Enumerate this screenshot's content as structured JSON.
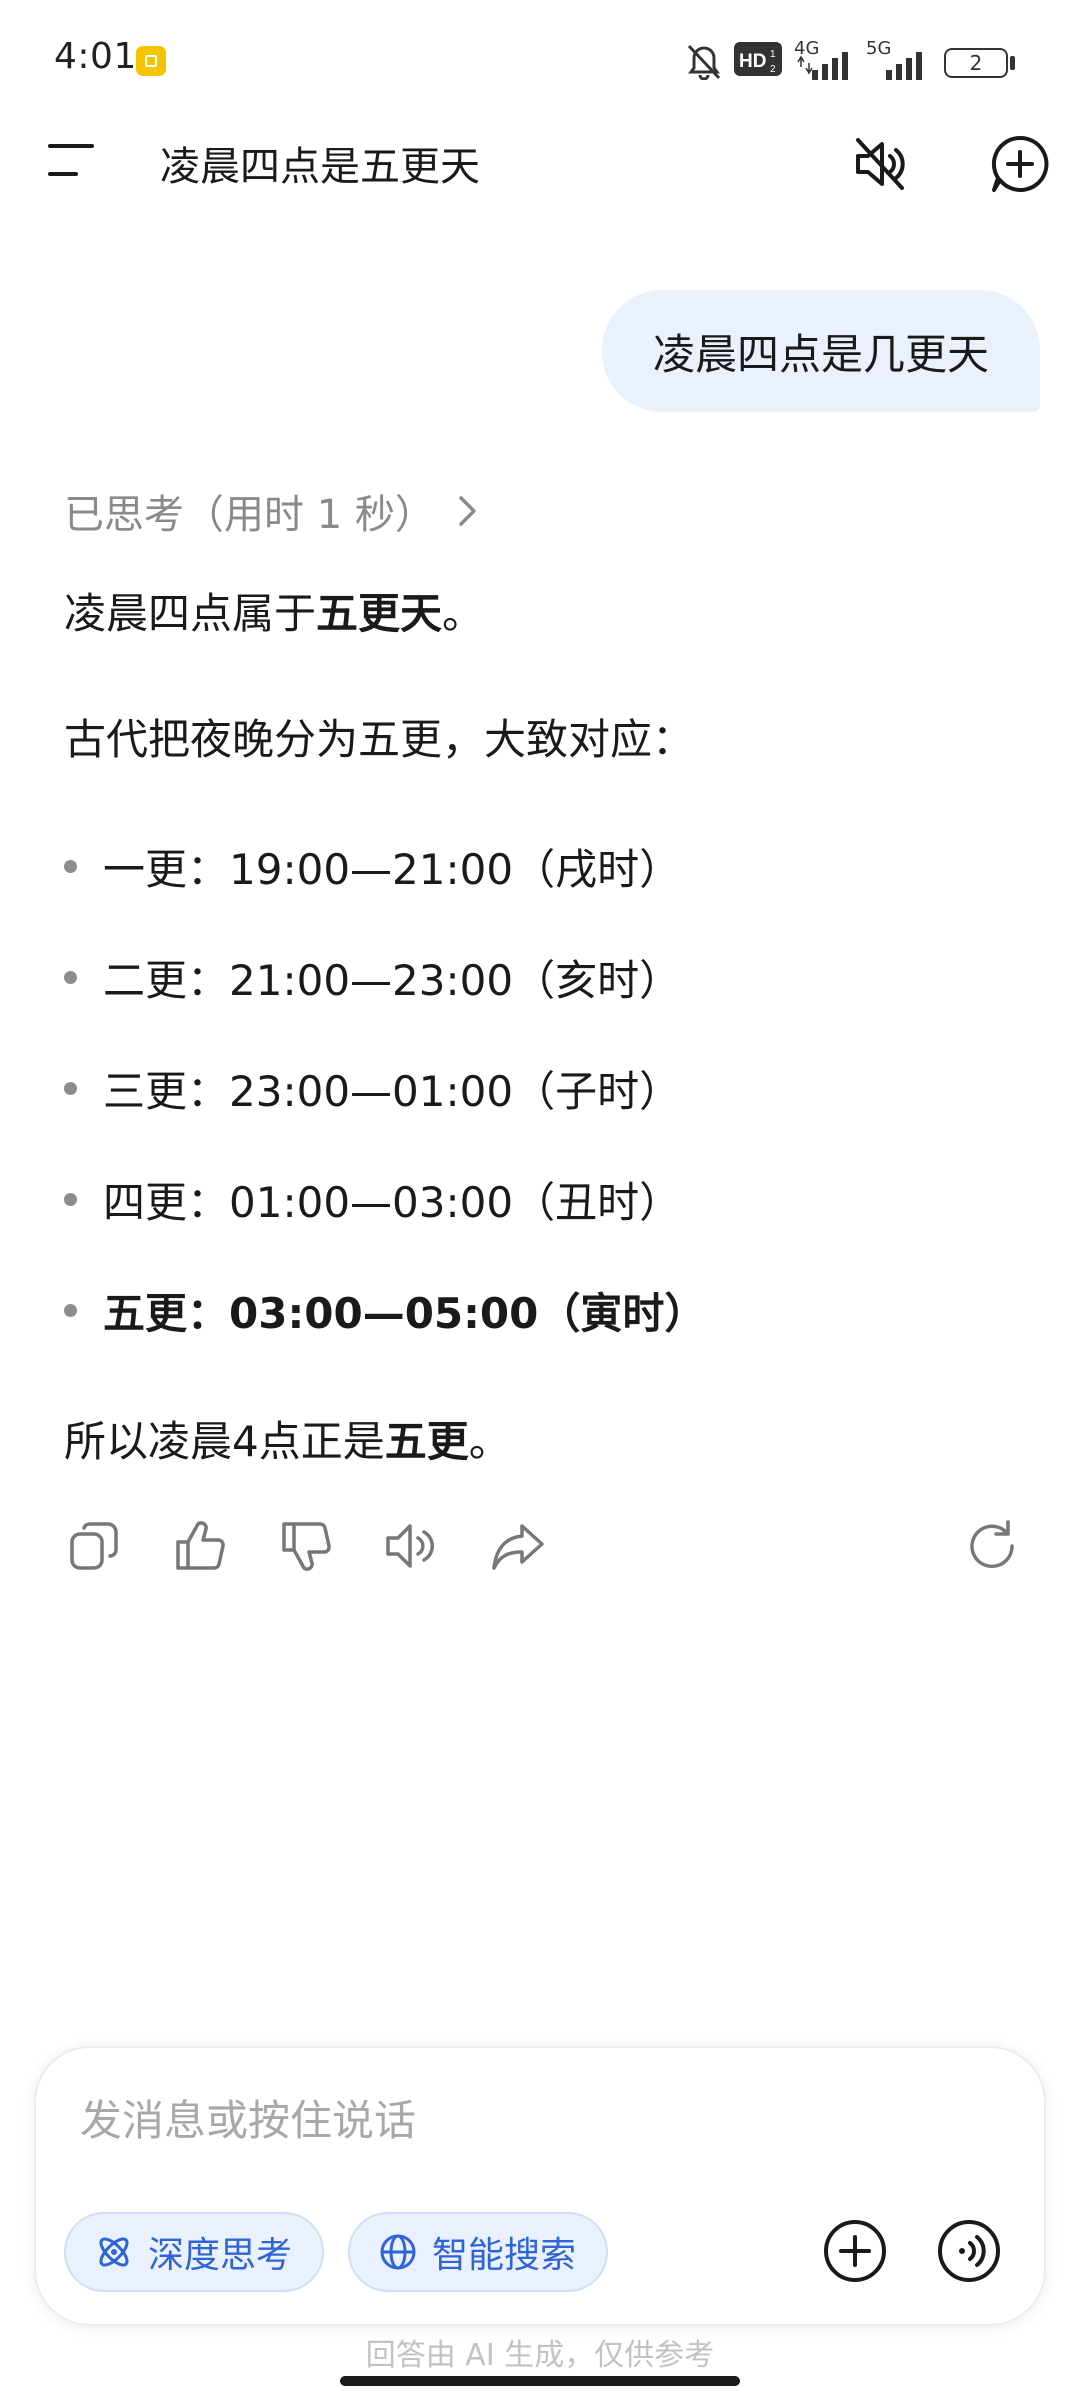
{
  "status_bar": {
    "time": "4:01",
    "network_1": "4G",
    "network_2": "5G",
    "battery": "2",
    "hd_label": "HD"
  },
  "header": {
    "title": "凌晨四点是五更天"
  },
  "conversation": {
    "user_message": "凌晨四点是几更天",
    "thinking_label": "已思考（用时 1 秒）",
    "answer": {
      "intro_prefix": "凌晨四点属于",
      "intro_bold": "五更天",
      "intro_suffix": "。",
      "para2": "古代把夜晚分为五更，大致对应：",
      "watches": [
        {
          "text": "一更：19:00—21:00（戌时）",
          "bold": false
        },
        {
          "text": "二更：21:00—23:00（亥时）",
          "bold": false
        },
        {
          "text": "三更：23:00—01:00（子时）",
          "bold": false
        },
        {
          "text": "四更：01:00—03:00（丑时）",
          "bold": false
        },
        {
          "text": "五更：03:00—05:00（寅时）",
          "bold": true
        }
      ],
      "conclusion_prefix": "所以凌晨4点正是",
      "conclusion_bold": "五更",
      "conclusion_suffix": "。"
    }
  },
  "actions": [
    "copy-icon",
    "thumbs-up-icon",
    "thumbs-down-icon",
    "speaker-icon",
    "share-icon",
    "regenerate-icon"
  ],
  "composer": {
    "placeholder": "发消息或按住说话",
    "chip_deep_think": "深度思考",
    "chip_smart_search": "智能搜索"
  },
  "disclaimer": "回答由 AI 生成，仅供参考",
  "colors": {
    "accent": "#2f63d8",
    "bubble": "#eaf1fd",
    "muted": "#8a8a8a"
  }
}
